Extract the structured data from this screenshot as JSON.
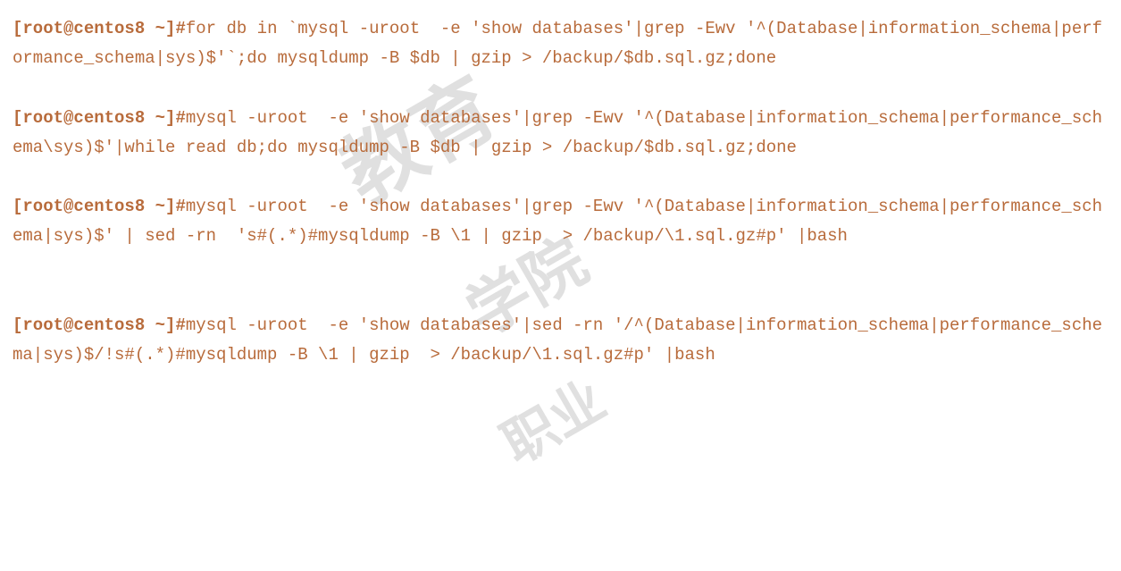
{
  "prompt": {
    "open": "[",
    "user_host": "root@centos8 ~",
    "close": "]#"
  },
  "commands": [
    {
      "text": "for db in `mysql -uroot  -e 'show databases'|grep -Ewv '^(Database|information_schema|performance_schema|sys)$'`;do mysqldump -B $db | gzip > /backup/$db.sql.gz;done"
    },
    {
      "text": "mysql -uroot  -e 'show databases'|grep -Ewv '^(Database|information_schema|performance_schema\\sys)$'|while read db;do mysqldump -B $db | gzip > /backup/$db.sql.gz;done"
    },
    {
      "text": "mysql -uroot  -e 'show databases'|grep -Ewv '^(Database|information_schema|performance_schema|sys)$' | sed -rn  's#(.*)#mysqldump -B \\1 | gzip  > /backup/\\1.sql.gz#p' |bash"
    },
    {
      "text": "mysql -uroot  -e 'show databases'|sed -rn '/^(Database|information_schema|performance_schema|sys)$/!s#(.*)#mysqldump -B \\1 | gzip  > /backup/\\1.sql.gz#p' |bash"
    }
  ],
  "watermark": {
    "a": "教育",
    "b": "学院",
    "c": "职业"
  },
  "extra_gap_after_index": 2
}
